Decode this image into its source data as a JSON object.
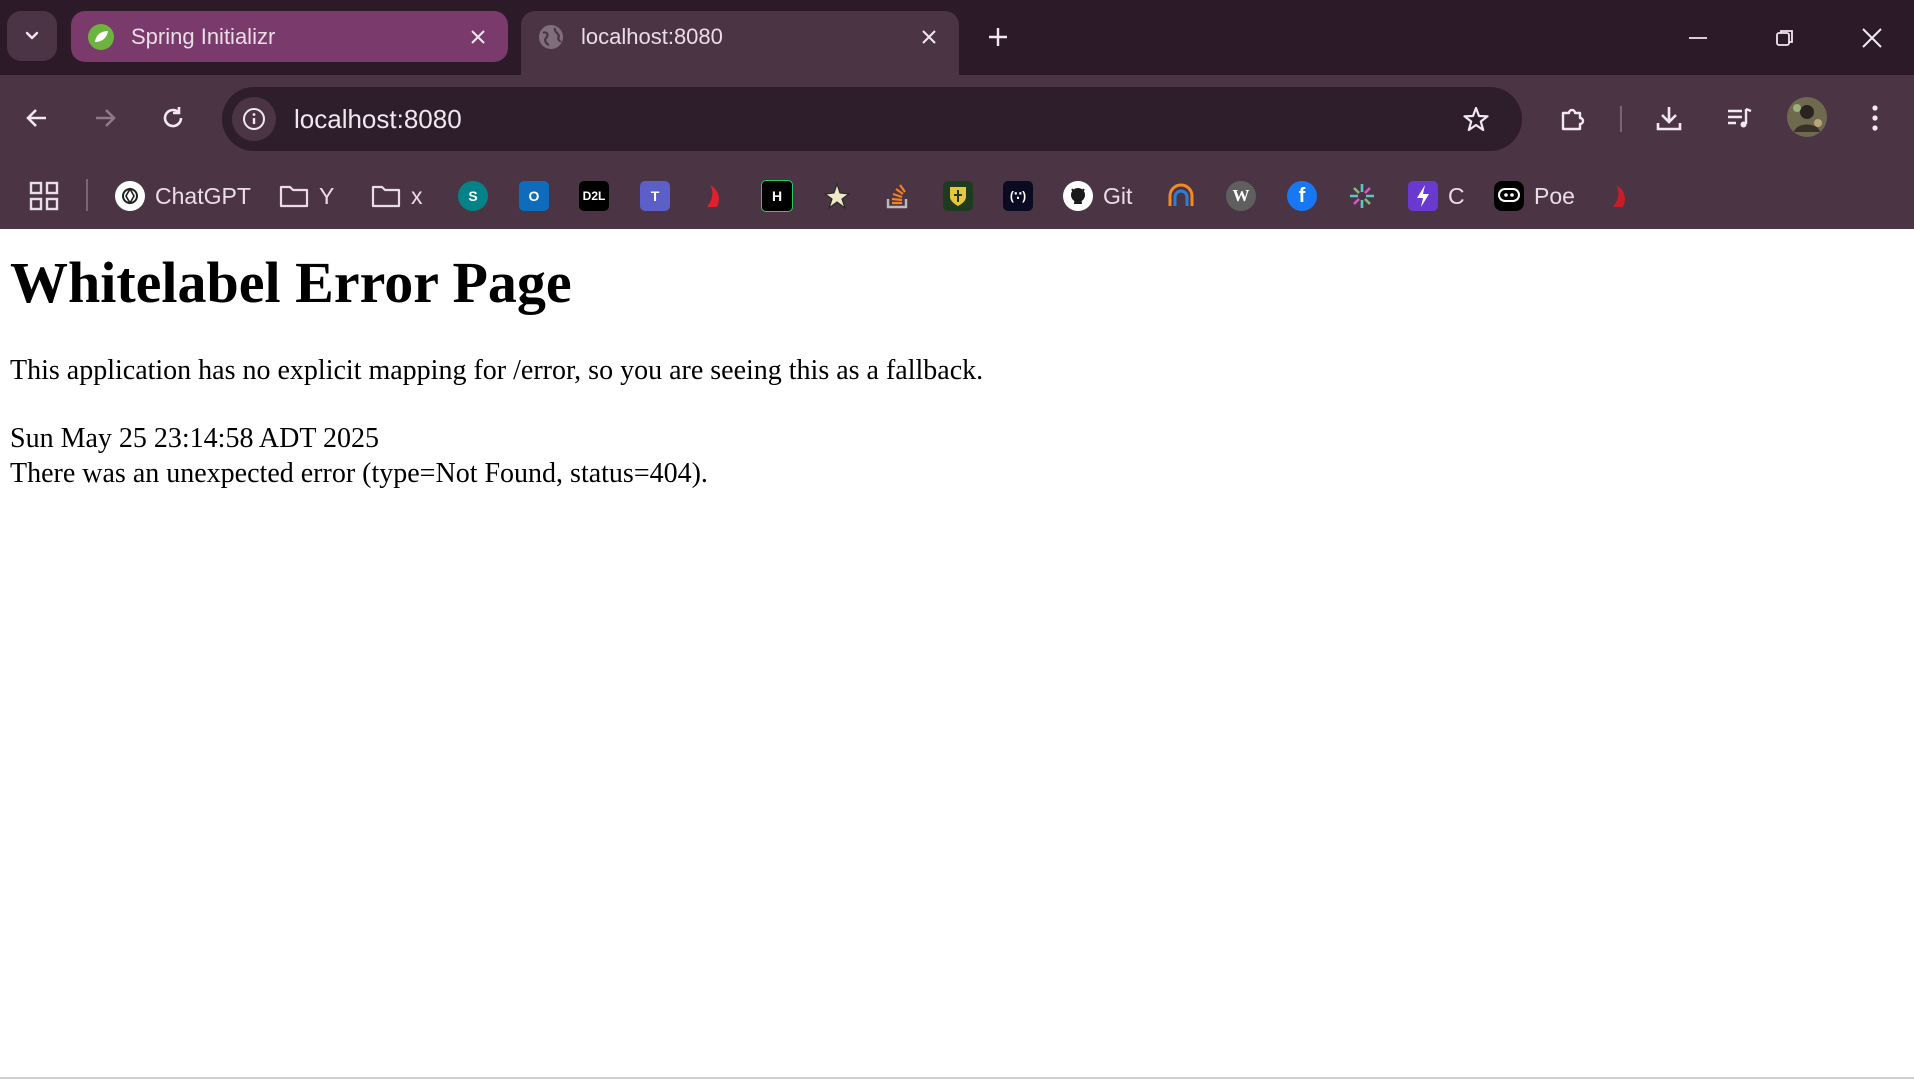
{
  "browser": {
    "tabs": [
      {
        "title": "Spring Initializr",
        "active": false,
        "favicon": "spring-leaf-icon"
      },
      {
        "title": "localhost:8080",
        "active": true,
        "favicon": "globe-icon"
      }
    ],
    "address_bar": {
      "url": "localhost:8080"
    },
    "bookmarks": [
      {
        "label": "ChatGPT",
        "icon": "chatgpt-icon"
      },
      {
        "label": "Y",
        "icon": "folder-icon"
      },
      {
        "label": "x",
        "icon": "folder-icon"
      },
      {
        "label": "",
        "icon": "sharepoint-icon"
      },
      {
        "label": "",
        "icon": "outlook-icon"
      },
      {
        "label": "",
        "icon": "d2l-icon",
        "text": "D2L"
      },
      {
        "label": "",
        "icon": "teams-icon"
      },
      {
        "label": "",
        "icon": "red-swoosh-icon"
      },
      {
        "label": "",
        "icon": "hackerrank-icon",
        "text": "H"
      },
      {
        "label": "",
        "icon": "star-burst-icon"
      },
      {
        "label": "",
        "icon": "stackoverflow-icon"
      },
      {
        "label": "",
        "icon": "crest-icon"
      },
      {
        "label": "",
        "icon": "freecodecamp-icon",
        "text": "(∵)"
      },
      {
        "label": "Git",
        "icon": "github-icon"
      },
      {
        "label": "",
        "icon": "arch-icon"
      },
      {
        "label": "",
        "icon": "wikipedia-icon",
        "text": "W"
      },
      {
        "label": "",
        "icon": "facebook-icon",
        "text": "f"
      },
      {
        "label": "",
        "icon": "sparkle-icon"
      },
      {
        "label": "C",
        "icon": "bolt-icon"
      },
      {
        "label": "Poe",
        "icon": "poe-icon"
      },
      {
        "label": "",
        "icon": "red-swoosh-icon"
      }
    ],
    "colors": {
      "tabstrip": "#2c1a29",
      "toolbar": "#4b3545",
      "inactive_tab": "#7a3a6c",
      "omnibox": "#2e1d2b"
    }
  },
  "page": {
    "heading": "Whitelabel Error Page",
    "message": "This application has no explicit mapping for /error, so you are seeing this as a fallback.",
    "timestamp": "Sun May 25 23:14:58 ADT 2025",
    "error_detail": "There was an unexpected error (type=Not Found, status=404)."
  }
}
